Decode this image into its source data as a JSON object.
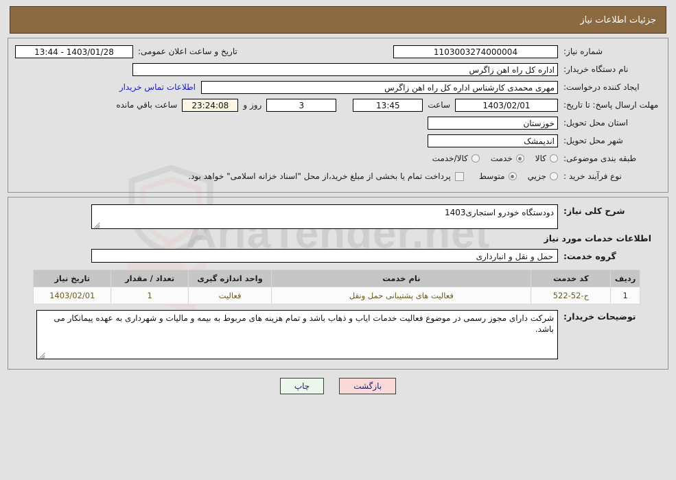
{
  "header": {
    "title": "جزئیات اطلاعات نیاز"
  },
  "watermark": {
    "text": "AriaTender.net"
  },
  "form": {
    "need_number_label": "شماره نیاز:",
    "need_number_value": "1103003274000004",
    "announce_label": "تاریخ و ساعت اعلان عمومی:",
    "announce_value": "1403/01/28 - 13:44",
    "buyer_org_label": "نام دستگاه خریدار:",
    "buyer_org_value": "اداره کل راه اهن زاگرس",
    "creator_label": "ایجاد کننده درخواست:",
    "creator_value": "مهری محمدی کارشناس اداره کل راه اهن زاگرس",
    "contact_link": "اطلاعات تماس خریدار",
    "deadline_label": "مهلت ارسال پاسخ: تا تاریخ:",
    "deadline_date": "1403/02/01",
    "hour_label": "ساعت",
    "deadline_time": "13:45",
    "days_value": "3",
    "days_label": "روز و",
    "countdown_value": "23:24:08",
    "remaining_label": "ساعت باقي مانده",
    "province_label": "استان محل تحویل:",
    "province_value": "خوزستان",
    "city_label": "شهر محل تحویل:",
    "city_value": "اندیمشک",
    "category_label": "طبقه بندی موضوعی:",
    "category_options": [
      {
        "label": "کالا",
        "checked": false
      },
      {
        "label": "خدمت",
        "checked": true
      },
      {
        "label": "کالا/خدمت",
        "checked": false
      }
    ],
    "process_label": "نوع فرآیند خرید :",
    "process_options": [
      {
        "label": "جزیي",
        "checked": false
      },
      {
        "label": "متوسط",
        "checked": true
      }
    ],
    "treasury_checkbox": {
      "label": "پرداخت تمام یا بخشی از مبلغ خرید،از محل \"اسناد خزانه اسلامی\" خواهد بود.",
      "checked": false
    }
  },
  "details": {
    "summary_label": "شرح کلی نیاز:",
    "summary_value": "دودستگاه خودرو استجاری1403",
    "services_title": "اطلاعات خدمات مورد نیاز",
    "service_group_label": "گروه خدمت:",
    "service_group_value": "حمل و نقل و انبارداری",
    "notes_label": "توضیحات خریدار:",
    "notes_value": "شرکت دارای مجوز رسمی در موضوع فعالیت خدمات ایاب و ذهاب باشد و تمام هزینه های مربوط به بیمه و مالیات و شهرداری به عهده پیمانکار می باشد."
  },
  "table": {
    "columns": [
      "ردیف",
      "کد خدمت",
      "نام خدمت",
      "واحد اندازه گیری",
      "تعداد / مقدار",
      "تاریخ نیاز"
    ],
    "rows": [
      {
        "radif": "1",
        "code": "ح-52-522",
        "name": "فعالیت های پشتیبانی حمل ونقل",
        "unit": "فعالیت",
        "qty": "1",
        "date": "1403/02/01"
      }
    ]
  },
  "buttons": {
    "print": "چاپ",
    "back": "بازگشت"
  },
  "colors": {
    "header_bg": "#8b6a42",
    "page_bg": "#e2e2e2",
    "link": "#1a1ad0",
    "countdown_bg": "#fbf7e4",
    "table_header_bg": "#c6c6c6",
    "print_btn_bg": "#eaf7ea",
    "back_btn_bg": "#fbd9d9"
  }
}
